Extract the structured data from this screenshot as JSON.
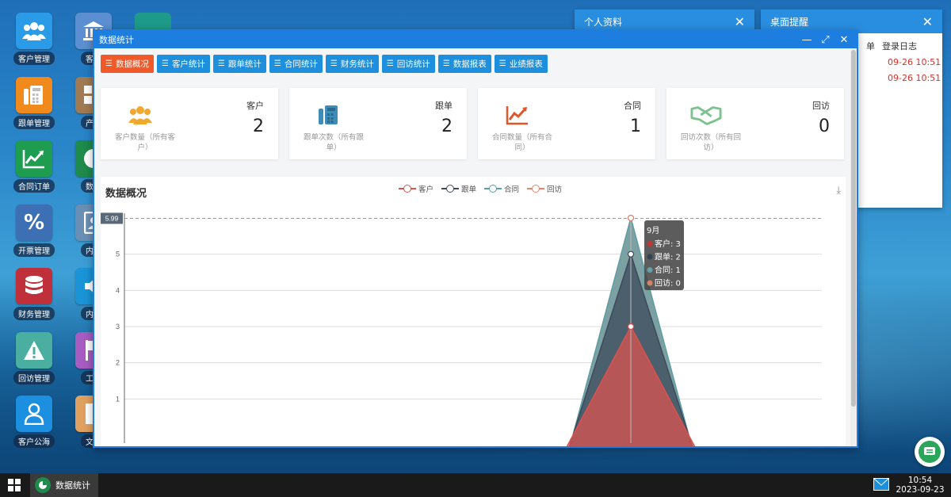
{
  "desktop": {
    "icons_col1": [
      {
        "label": "客户管理",
        "icon": "users-icon",
        "color": "#2b9be8"
      },
      {
        "label": "跟单管理",
        "icon": "calculator-icon",
        "color": "#f08a1c"
      },
      {
        "label": "合同订单",
        "icon": "line-chart-icon",
        "color": "#1e9c50"
      },
      {
        "label": "开票管理",
        "icon": "percent-icon",
        "color": "#3d6fb5"
      },
      {
        "label": "财务管理",
        "icon": "database-icon",
        "color": "#c0303a"
      },
      {
        "label": "回访管理",
        "icon": "warning-icon",
        "color": "#4aaea0"
      },
      {
        "label": "客户公海",
        "icon": "user-icon",
        "color": "#1c8fe0"
      }
    ],
    "icons_col2": [
      {
        "label": "客户",
        "icon": "bank-icon",
        "color": "#5b8fd1"
      },
      {
        "label": "产品",
        "icon": "grid-icon",
        "color": "#a07a52"
      },
      {
        "label": "数据",
        "icon": "pie-chart-icon",
        "color": "#1e8a4c"
      },
      {
        "label": "内部",
        "icon": "contact-icon",
        "color": "#6a8fb5"
      },
      {
        "label": "内部",
        "icon": "speaker-icon",
        "color": "#1a94d6"
      },
      {
        "label": "工作",
        "icon": "flag-icon",
        "color": "#a65cc0"
      },
      {
        "label": "文件",
        "icon": "file-icon",
        "color": "#e0a060"
      }
    ]
  },
  "side_windows": {
    "profile": {
      "title": "个人资料"
    },
    "reminder": {
      "title": "桌面提醒",
      "col_header": "登录日志",
      "col_header_partial": "单",
      "entries": [
        "09-26 10:51",
        "09-26 10:51"
      ]
    }
  },
  "window": {
    "title": "数据统计",
    "tabs": [
      "数据概况",
      "客户统计",
      "跟单统计",
      "合同统计",
      "财务统计",
      "回访统计",
      "数据报表",
      "业绩报表"
    ],
    "cards": [
      {
        "name": "客户",
        "value": "2",
        "label": "客户数量（所有客户）",
        "icon": "users-icon",
        "color": "#f0a830"
      },
      {
        "name": "跟单",
        "value": "2",
        "label": "跟单次数（所有跟单）",
        "icon": "calculator-icon",
        "color": "#3d8db8"
      },
      {
        "name": "合同",
        "value": "1",
        "label": "合同数量（所有合同）",
        "icon": "line-chart-icon",
        "color": "#e0552a"
      },
      {
        "name": "回访",
        "value": "0",
        "label": "回访次数（所有回访）",
        "icon": "handshake-icon",
        "color": "#7cc28e"
      }
    ],
    "chart_title": "数据概况"
  },
  "chart_data": {
    "type": "area",
    "x": [
      "9月"
    ],
    "series": [
      {
        "name": "客户",
        "color": "#d9534f",
        "peak": 3
      },
      {
        "name": "跟单",
        "color": "#3c4a5a",
        "peak": 5
      },
      {
        "name": "合同",
        "color": "#5aa0a8",
        "peak": 6
      },
      {
        "name": "回访",
        "color": "#e0856a",
        "peak": 6
      }
    ],
    "y_ticks": [
      1,
      2,
      3,
      4,
      5
    ],
    "y_pointer": "5.99",
    "ylim": [
      0,
      6
    ],
    "grid": true,
    "tooltip": {
      "title": "9月",
      "rows": [
        {
          "label": "客户",
          "value": "3",
          "color": "#c23531"
        },
        {
          "label": "跟单",
          "value": "2",
          "color": "#2f4554"
        },
        {
          "label": "合同",
          "value": "1",
          "color": "#61a0a8"
        },
        {
          "label": "回访",
          "value": "0",
          "color": "#d48265"
        }
      ]
    }
  },
  "taskbar": {
    "task": "数据统计",
    "time": "10:54",
    "date": "2023-09-23"
  }
}
